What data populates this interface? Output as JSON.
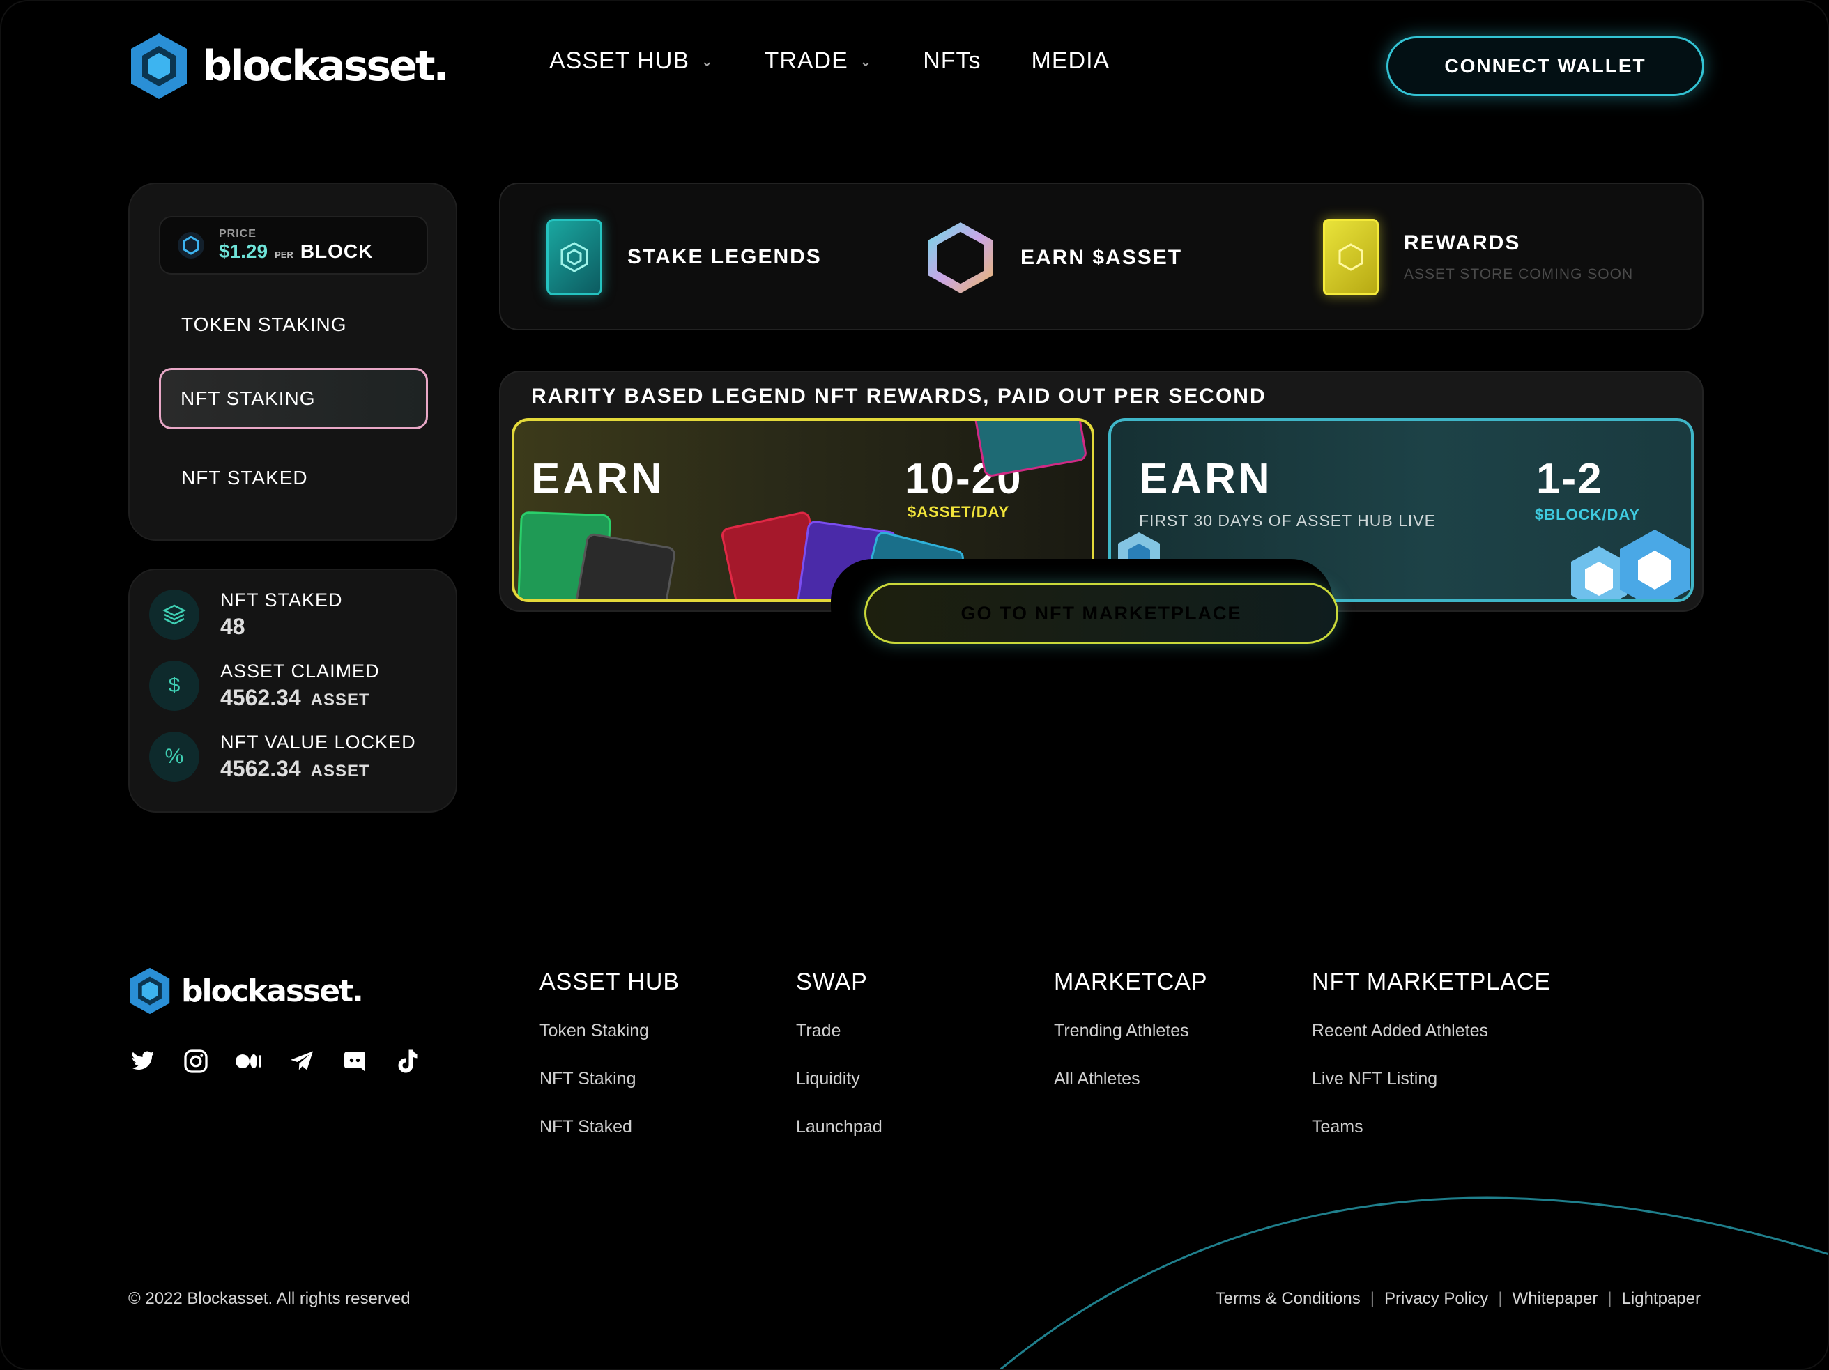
{
  "header": {
    "logo_text": "blockasset.",
    "nav": [
      {
        "label": "ASSET HUB",
        "has_dropdown": true
      },
      {
        "label": "TRADE",
        "has_dropdown": true
      },
      {
        "label": "NFTs",
        "has_dropdown": false
      },
      {
        "label": "MEDIA",
        "has_dropdown": false
      }
    ],
    "connect_label": "CONNECT WALLET"
  },
  "sidebar": {
    "price_label": "PRICE",
    "price_value": "$1.29",
    "per_label": "PER",
    "token": "BLOCK",
    "items": [
      {
        "label": "TOKEN STAKING",
        "active": false
      },
      {
        "label": "NFT STAKING",
        "active": true
      },
      {
        "label": "NFT STAKED",
        "active": false
      }
    ]
  },
  "stats": [
    {
      "label": "NFT STAKED",
      "value": "48",
      "unit": "",
      "icon": "layers-icon"
    },
    {
      "label": "ASSET CLAIMED",
      "value": "4562.34",
      "unit": "ASSET",
      "icon": "dollar-icon"
    },
    {
      "label": "NFT VALUE LOCKED",
      "value": "4562.34",
      "unit": "ASSET",
      "icon": "percent-icon"
    }
  ],
  "features": [
    {
      "title": "STAKE LEGENDS",
      "subtitle": ""
    },
    {
      "title": "EARN $ASSET",
      "subtitle": ""
    },
    {
      "title": "REWARDS",
      "subtitle": "ASSET STORE COMING SOON"
    }
  ],
  "rewards": {
    "title": "RARITY BASED LEGEND NFT REWARDS, PAID OUT PER SECOND",
    "left": {
      "earn": "EARN",
      "range": "10-20",
      "unit": "$ASSET/DAY"
    },
    "right": {
      "earn": "EARN",
      "note": "FIRST 30 DAYS OF ASSET HUB LIVE",
      "range": "1-2",
      "unit": "$BLOCK/DAY"
    },
    "cta": "GO TO NFT MARKETPLACE"
  },
  "footer": {
    "logo_text": "blockasset.",
    "columns": [
      {
        "heading": "ASSET HUB",
        "links": [
          "Token Staking",
          "NFT Staking",
          "NFT Staked"
        ]
      },
      {
        "heading": "SWAP",
        "links": [
          "Trade",
          "Liquidity",
          "Launchpad"
        ]
      },
      {
        "heading": "MARKETCAP",
        "links": [
          "Trending Athletes",
          "All Athletes"
        ]
      },
      {
        "heading": "NFT MARKETPLACE",
        "links": [
          "Recent Added Athletes",
          "Live NFT Listing",
          "Teams"
        ]
      }
    ],
    "copyright": "© 2022 Blockasset. All rights reserved",
    "legal": [
      "Terms & Conditions",
      "Privacy Policy",
      "Whitepaper",
      "Lightpaper"
    ],
    "social_icons": [
      "twitter-icon",
      "instagram-icon",
      "medium-icon",
      "telegram-icon",
      "discord-icon",
      "tiktok-icon"
    ]
  },
  "colors": {
    "accent_teal": "#33c3d4",
    "accent_yellow": "#e3d93a",
    "active_border": "#e9a8c7"
  }
}
